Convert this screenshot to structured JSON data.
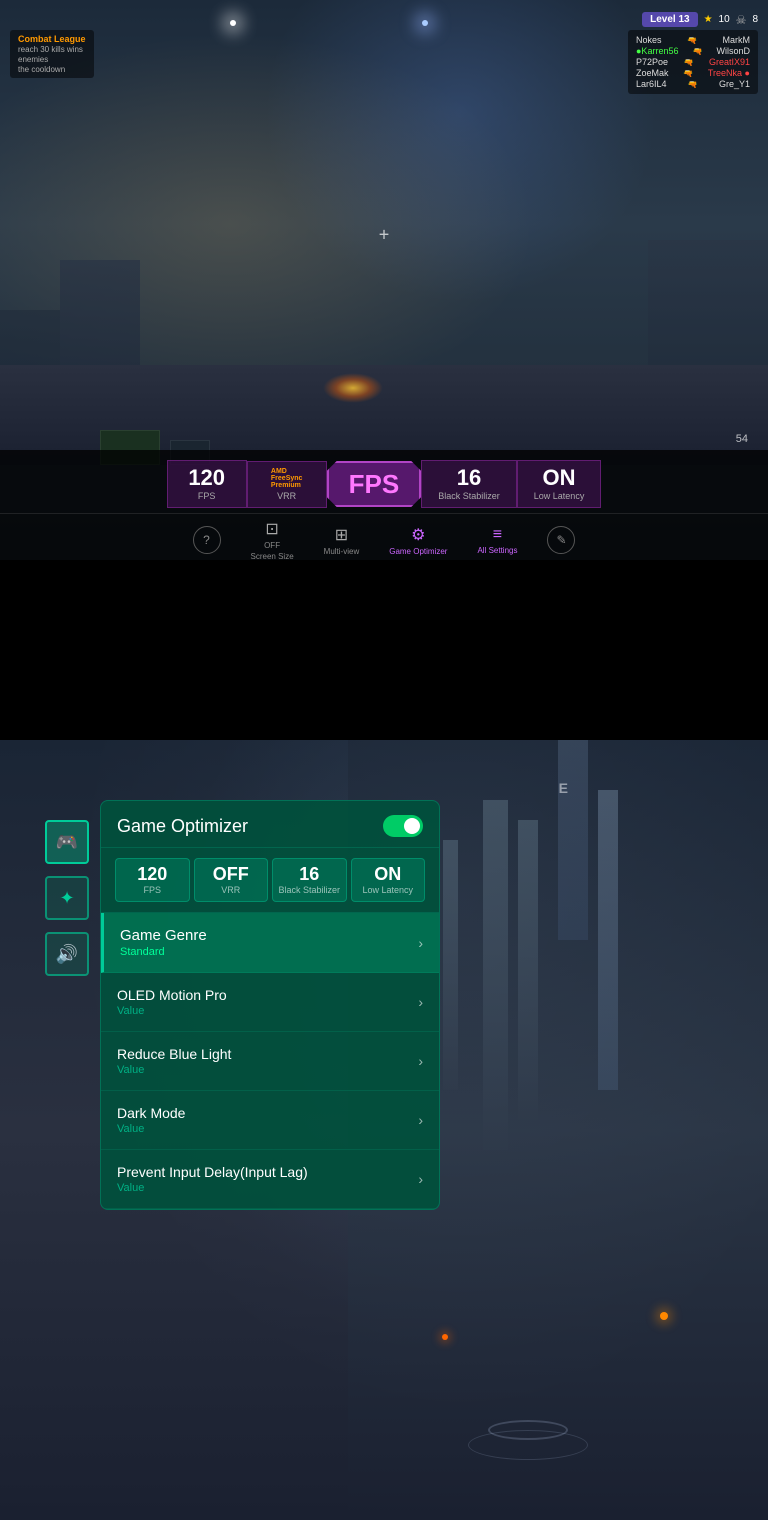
{
  "top_section": {
    "game_name": "Combat League",
    "level": "Level 13",
    "star_count": "10",
    "skull_count": "8",
    "players": [
      {
        "name": "Nokes",
        "team": "left",
        "opponent": "MarkM",
        "team2": "right"
      },
      {
        "name": "Karren56",
        "team": "left",
        "opponent": "WilsonD",
        "team2": "right"
      },
      {
        "name": "P72Poe",
        "team": "left",
        "opponent": "GreatIX91",
        "team2": "right"
      },
      {
        "name": "ZoeMak",
        "team": "left",
        "opponent": "TreeNka",
        "team2": "right"
      },
      {
        "name": "Lar6IL4",
        "team": "left",
        "opponent": "Gre_Y1",
        "team2": "right"
      }
    ],
    "hud": {
      "match_type": "Combat League",
      "kill_text": "reach 30 kills wins",
      "enemy_text": "enemies",
      "cooldown_text": "the cooldown"
    },
    "stats": {
      "fps_value": "120",
      "fps_label": "FPS",
      "freesync_label": "FreeSync",
      "freesync_sub": "Premium",
      "vrr_label": "VRR",
      "center_fps": "FPS",
      "black_stabilizer_value": "16",
      "black_stabilizer_label": "Black Stabilizer",
      "low_latency_value": "ON",
      "low_latency_label": "Low Latency"
    },
    "nav": [
      {
        "label": "",
        "type": "circle",
        "icon": "?"
      },
      {
        "label": "Screen Size",
        "value": "OFF",
        "icon": "⊞"
      },
      {
        "label": "Multi-view",
        "icon": "⊡"
      },
      {
        "label": "Game Optimizer",
        "icon": "≡",
        "active": true
      },
      {
        "label": "All Settings",
        "icon": "⚙",
        "active": true
      },
      {
        "label": "",
        "type": "circle",
        "icon": "✎"
      }
    ],
    "ammo": "54"
  },
  "bottom_section": {
    "e_marker": "E",
    "sidebar_icons": [
      {
        "icon": "🎮",
        "label": "game",
        "active": true
      },
      {
        "icon": "✦",
        "label": "display"
      },
      {
        "icon": "🔊",
        "label": "sound"
      }
    ],
    "optimizer": {
      "title": "Game Optimizer",
      "toggle_on": true,
      "stats": [
        {
          "value": "120",
          "label": "FPS"
        },
        {
          "value": "OFF",
          "label": "VRR"
        },
        {
          "value": "16",
          "label": "Black Stabilizer"
        },
        {
          "value": "ON",
          "label": "Low Latency"
        }
      ],
      "menu_items": [
        {
          "title": "Game Genre",
          "subtitle": "Standard",
          "highlighted": true,
          "id": "game-genre"
        },
        {
          "title": "OLED Motion Pro",
          "subtitle": "Value",
          "highlighted": false,
          "id": "oled-motion-pro"
        },
        {
          "title": "Reduce Blue Light",
          "subtitle": "Value",
          "highlighted": false,
          "id": "reduce-blue-light"
        },
        {
          "title": "Dark Mode",
          "subtitle": "Value",
          "highlighted": false,
          "id": "dark-mode"
        },
        {
          "title": "Prevent Input Delay(Input Lag)",
          "subtitle": "Value",
          "highlighted": false,
          "id": "prevent-input-delay"
        }
      ]
    }
  }
}
